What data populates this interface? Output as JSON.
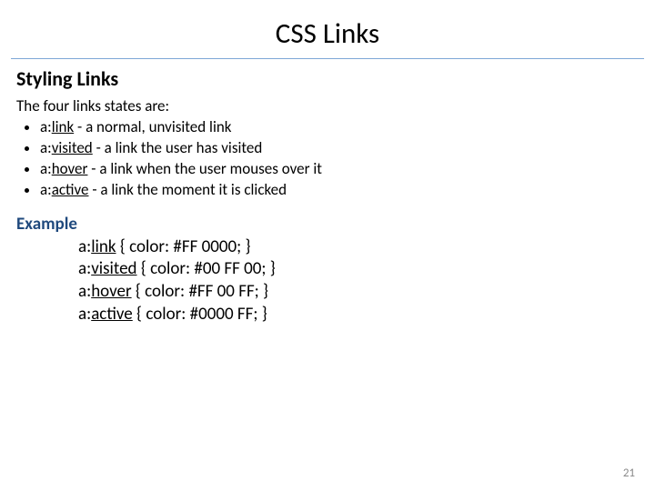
{
  "title": "CSS Links",
  "subtitle": "Styling Links",
  "intro": "The four links states are:",
  "states": [
    {
      "prefix": "a:",
      "name": "link",
      "desc": " - a normal, unvisited link"
    },
    {
      "prefix": "a:",
      "name": "visited",
      "desc": " - a link the user has visited"
    },
    {
      "prefix": "a:",
      "name": "hover",
      "desc": " - a link when the user mouses over it"
    },
    {
      "prefix": "a:",
      "name": "active",
      "desc": " - a link the moment it is clicked"
    }
  ],
  "example_label": "Example",
  "code": [
    {
      "prefix": "a:",
      "name": "link",
      "rest": " { color: #FF 0000; }"
    },
    {
      "prefix": "a:",
      "name": "visited",
      "rest": " { color: #00 FF 00; }"
    },
    {
      "prefix": "a:",
      "name": "hover",
      "rest": " { color: #FF 00 FF; }"
    },
    {
      "prefix": "a:",
      "name": "active",
      "rest": " { color: #0000 FF; }"
    }
  ],
  "page_number": "21"
}
